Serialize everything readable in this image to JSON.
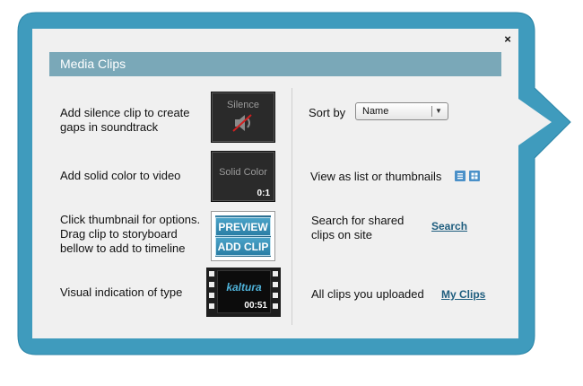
{
  "window": {
    "close_label": "×"
  },
  "header": {
    "title": "Media Clips"
  },
  "left": {
    "silence": {
      "description": "Add silence clip to create gaps in soundtrack",
      "thumb_label": "Silence"
    },
    "solid": {
      "description": "Add solid color to video",
      "thumb_label": "Solid Color",
      "duration": "0:1"
    },
    "preview": {
      "description": "Click thumbnail for options. Drag clip to storyboard bellow to add to timeline",
      "preview_label": "PREVIEW",
      "add_label": "ADD CLIP"
    },
    "type": {
      "description": "Visual indication of type",
      "logo_text": "kaltura",
      "duration": "00:51"
    }
  },
  "right": {
    "sort": {
      "label": "Sort by",
      "value": "Name"
    },
    "view": {
      "label": "View as list or thumbnails"
    },
    "search": {
      "label": "Search for shared clips on site",
      "link": "Search"
    },
    "my_clips": {
      "label": "All clips you uploaded",
      "link": "My Clips"
    }
  },
  "colors": {
    "frame": "#3f9bbd",
    "header": "#7aa8b8",
    "link": "#1e5d7e"
  },
  "icons": [
    "close-icon",
    "muted-speaker-icon",
    "list-view-icon",
    "thumbnail-view-icon",
    "dropdown-arrow-icon"
  ]
}
